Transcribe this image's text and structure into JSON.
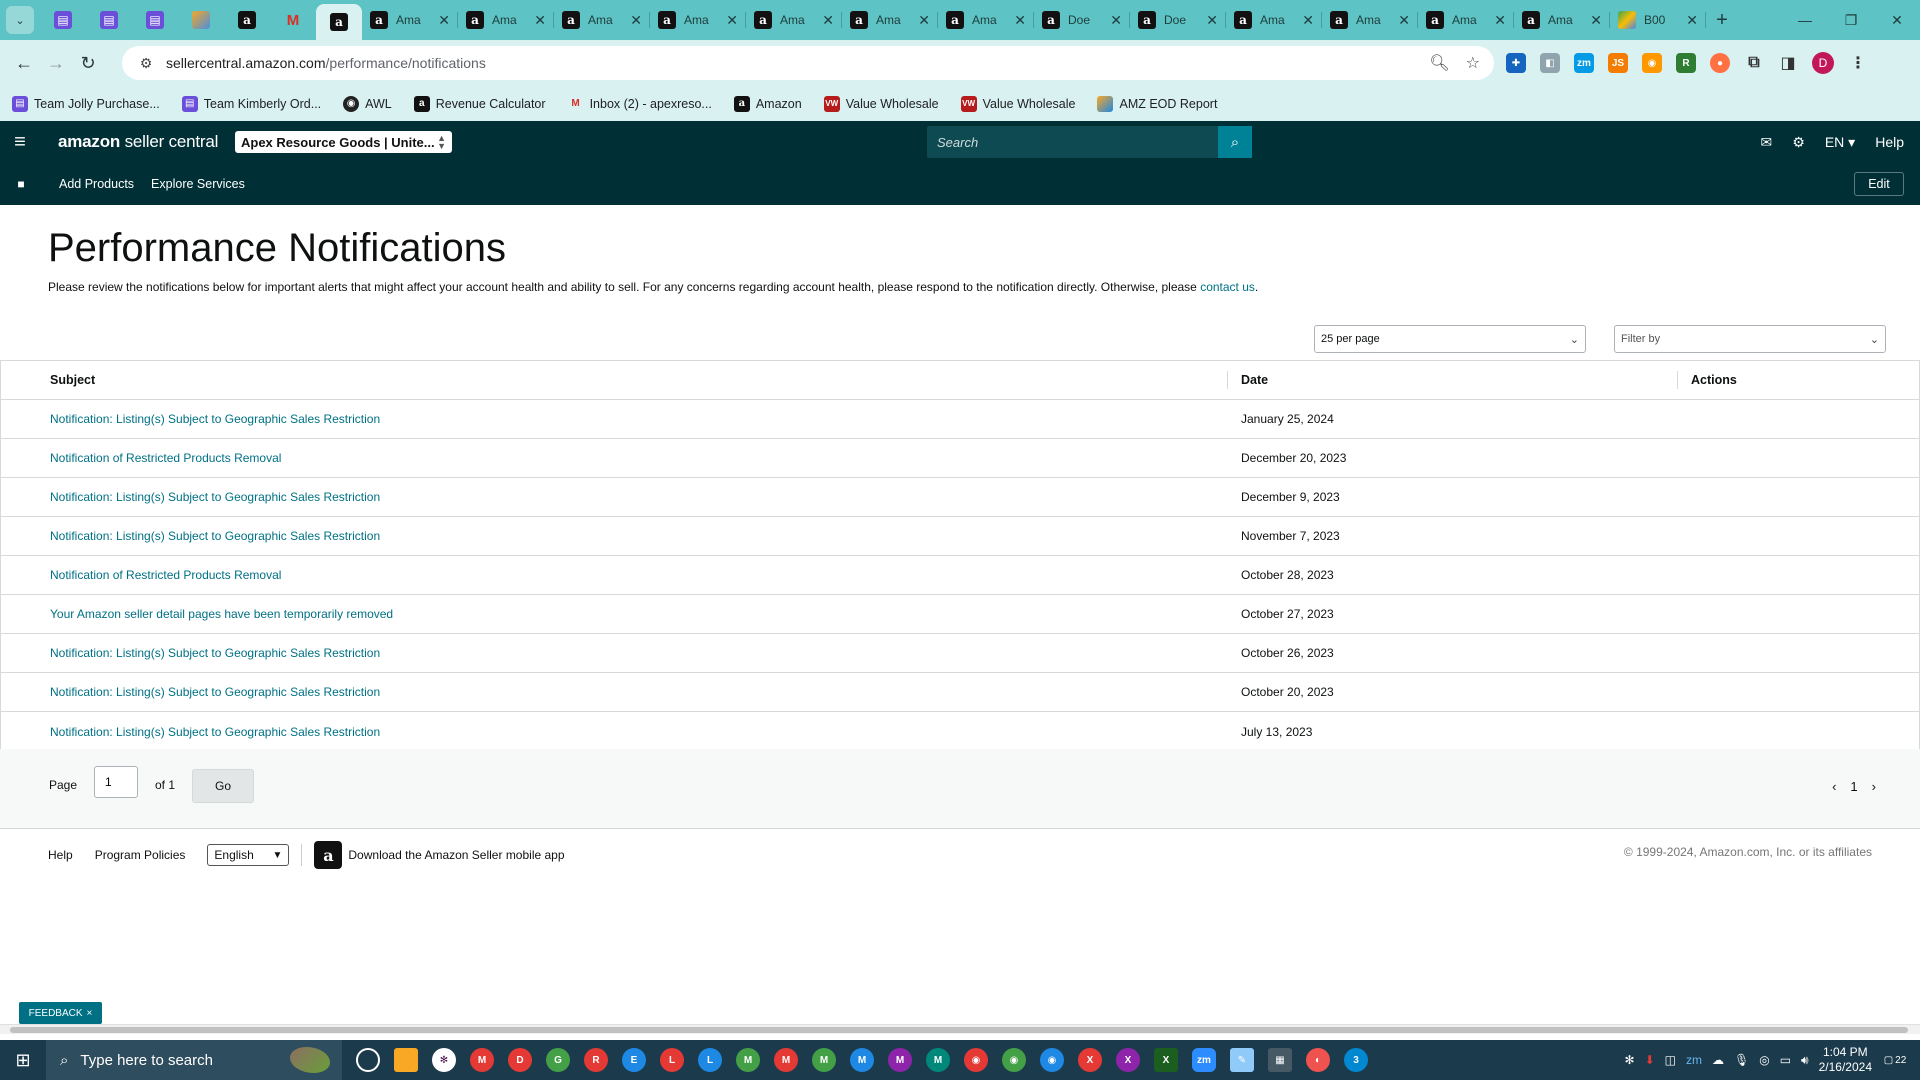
{
  "browser": {
    "tabs": [
      {
        "title": "Ama",
        "favicon": "amazon"
      },
      {
        "title": "Ama",
        "favicon": "amazon"
      },
      {
        "title": "Ama",
        "favicon": "amazon"
      },
      {
        "title": "Ama",
        "favicon": "amazon"
      },
      {
        "title": "Ama",
        "favicon": "amazon"
      },
      {
        "title": "Ama",
        "favicon": "amazon"
      },
      {
        "title": "Ama",
        "favicon": "amazon"
      },
      {
        "title": "Doe",
        "favicon": "amazon"
      },
      {
        "title": "Doe",
        "favicon": "amazon"
      },
      {
        "title": "Ama",
        "favicon": "amazon"
      },
      {
        "title": "Ama",
        "favicon": "amazon"
      },
      {
        "title": "Ama",
        "favicon": "amazon"
      },
      {
        "title": "Ama",
        "favicon": "amazon"
      },
      {
        "title": "B00",
        "favicon": "drive"
      }
    ],
    "url_host": "sellercentral.amazon.com",
    "url_path": "/performance/notifications",
    "profile_initial": "D",
    "bookmarks": [
      {
        "label": "Team Jolly Purchase...",
        "icon": "sheets"
      },
      {
        "label": "Team Kimberly Ord...",
        "icon": "sheets"
      },
      {
        "label": "AWL",
        "icon": "awl"
      },
      {
        "label": "Revenue Calculator",
        "icon": "calc"
      },
      {
        "label": "Inbox (2) - apexreso...",
        "icon": "gmail"
      },
      {
        "label": "Amazon",
        "icon": "amazon"
      },
      {
        "label": "Value Wholesale",
        "icon": "vw"
      },
      {
        "label": "Value Wholesale",
        "icon": "vw"
      },
      {
        "label": "AMZ EOD Report",
        "icon": "eod"
      }
    ]
  },
  "header": {
    "logo_bold": "amazon",
    "logo_rest": " seller central",
    "store": "Apex Resource Goods | Unite...",
    "search_placeholder": "Search",
    "language": "EN",
    "help": "Help"
  },
  "subnav": {
    "links": [
      "Add Products",
      "Explore Services"
    ],
    "edit": "Edit"
  },
  "page": {
    "title": "Performance Notifications",
    "description": "Please review the notifications below for important alerts that might affect your account health and ability to sell. For any concerns regarding account health, please respond to the notification directly. Otherwise, please ",
    "contact_link": "contact us",
    "description_end": "."
  },
  "controls": {
    "per_page": "25 per page",
    "filter_by": "Filter by"
  },
  "table": {
    "headers": {
      "subject": "Subject",
      "date": "Date",
      "actions": "Actions"
    },
    "rows": [
      {
        "subject": "Notification: Listing(s) Subject to Geographic Sales Restriction",
        "date": "January 25, 2024"
      },
      {
        "subject": "Notification of Restricted Products Removal",
        "date": "December 20, 2023"
      },
      {
        "subject": "Notification: Listing(s) Subject to Geographic Sales Restriction",
        "date": "December 9, 2023"
      },
      {
        "subject": "Notification: Listing(s) Subject to Geographic Sales Restriction",
        "date": "November 7, 2023"
      },
      {
        "subject": "Notification of Restricted Products Removal",
        "date": "October 28, 2023"
      },
      {
        "subject": "Your Amazon seller detail pages have been temporarily removed",
        "date": "October 27, 2023"
      },
      {
        "subject": "Notification: Listing(s) Subject to Geographic Sales Restriction",
        "date": "October 26, 2023"
      },
      {
        "subject": "Notification: Listing(s) Subject to Geographic Sales Restriction",
        "date": "October 20, 2023"
      },
      {
        "subject": "Notification: Listing(s) Subject to Geographic Sales Restriction",
        "date": "July 13, 2023"
      }
    ]
  },
  "pager": {
    "page_label": "Page",
    "page_value": "1",
    "of_label": "of 1",
    "go": "Go",
    "current": "1"
  },
  "footer": {
    "help": "Help",
    "policies": "Program Policies",
    "language": "English",
    "app_text": "Download the Amazon Seller mobile app",
    "copyright": "© 1999-2024, Amazon.com, Inc. or its affiliates"
  },
  "feedback": {
    "label": "FEEDBACK",
    "close": "×"
  },
  "taskbar": {
    "search_placeholder": "Type here to search",
    "time": "1:04 PM",
    "date": "2/16/2024",
    "notifications": "22"
  },
  "colors": {
    "header_bg": "#002f36",
    "link": "#007185",
    "chrome_tabstrip": "#5ec3c4",
    "chrome_toolbar": "#d9f1f1"
  }
}
